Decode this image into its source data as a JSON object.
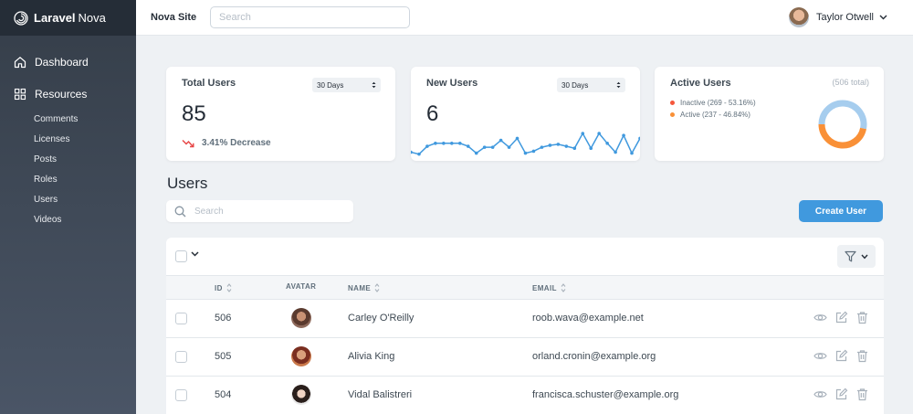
{
  "brand": {
    "name": "Laravel",
    "name2": "Nova"
  },
  "sidebar": {
    "dashboard": "Dashboard",
    "resources": "Resources",
    "items": [
      "Comments",
      "Licenses",
      "Posts",
      "Roles",
      "Users",
      "Videos"
    ]
  },
  "header": {
    "site_title": "Nova Site",
    "search_placeholder": "Search",
    "user_name": "Taylor Otwell"
  },
  "metrics": {
    "total_users": {
      "title": "Total Users",
      "range": "30 Days",
      "value": "85",
      "trend": "3.41% Decrease"
    },
    "new_users": {
      "title": "New Users",
      "range": "30 Days",
      "value": "6",
      "sparkline": [
        6,
        4,
        12,
        15,
        15,
        15,
        15,
        12,
        5,
        11,
        11,
        18,
        11,
        20,
        5,
        7,
        11,
        13,
        14,
        12,
        10,
        25,
        10,
        25,
        15,
        6,
        23,
        5,
        20
      ]
    },
    "active_users": {
      "title": "Active Users",
      "total": "(506 total)",
      "legend": [
        {
          "label": "Inactive (269 - 53.16%)",
          "color": "#f5573b",
          "value": 269
        },
        {
          "label": "Active (237 - 46.84%)",
          "color": "#f99037",
          "value": 237
        }
      ],
      "ring_colors": {
        "inactive": "#a6cdee",
        "active": "#f99037"
      }
    }
  },
  "users": {
    "title": "Users",
    "search_placeholder": "Search",
    "create_label": "Create User",
    "columns": {
      "id": "ID",
      "avatar": "AVATAR",
      "name": "NAME",
      "email": "EMAIL"
    },
    "rows": [
      {
        "id": "506",
        "name": "Carley O'Reilly",
        "email": "roob.wava@example.net"
      },
      {
        "id": "505",
        "name": "Alivia King",
        "email": "orland.cronin@example.org"
      },
      {
        "id": "504",
        "name": "Vidal Balistreri",
        "email": "francisca.schuster@example.org"
      }
    ]
  }
}
